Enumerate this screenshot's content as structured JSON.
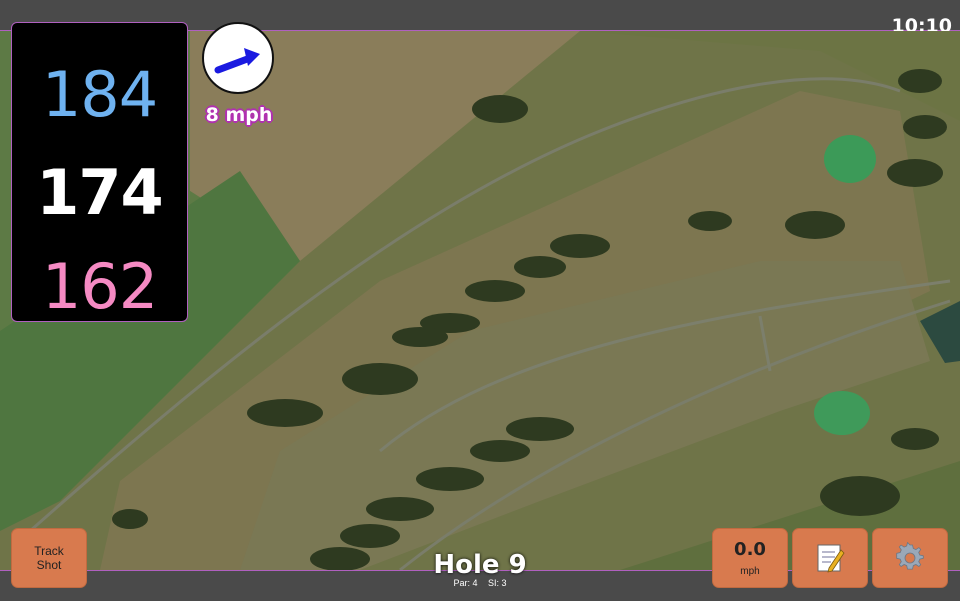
{
  "status_bar": {
    "time": "10:10"
  },
  "distances": {
    "back": "184",
    "middle": "174",
    "front": "162"
  },
  "wind": {
    "speed_label": "8 mph",
    "direction_icon": "arrow-up-right-icon",
    "arrow_color": "#1a1ae0"
  },
  "buttons": {
    "track_shot_line1": "Track",
    "track_shot_line2": "Shot",
    "speed_value": "0.0",
    "speed_unit": "mph",
    "notes_icon": "notepad-icon",
    "settings_icon": "gear-icon"
  },
  "hole": {
    "title": "Hole 9",
    "par": "Par: 4",
    "si": "SI: 3"
  },
  "colors": {
    "back_distance": "#6fb2f0",
    "middle_distance": "#ffffff",
    "front_distance": "#f58ac3",
    "button_bg": "#d87a4e",
    "accent_border": "#b060c0"
  }
}
